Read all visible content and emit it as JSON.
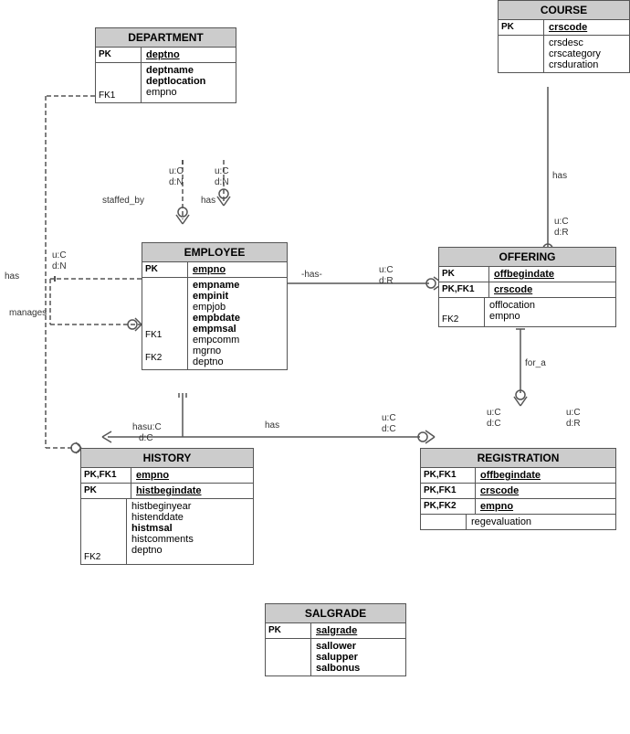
{
  "entities": {
    "department": {
      "title": "DEPARTMENT",
      "pk_label": "PK",
      "pk_field": "deptno",
      "fk_label": "FK1",
      "fields": [
        "deptname",
        "deptlocation",
        "empno"
      ],
      "bold_fields": [
        "deptname",
        "deptlocation"
      ]
    },
    "employee": {
      "title": "EMPLOYEE",
      "pk_label": "PK",
      "pk_field": "empno",
      "fk_labels": [
        "FK1",
        "FK2"
      ],
      "fields": [
        "empname",
        "empinit",
        "empjob",
        "empbdate",
        "empmsal",
        "empcomm",
        "mgrno",
        "deptno"
      ],
      "bold_fields": [
        "empname",
        "empinit",
        "empbdate",
        "empmsal"
      ]
    },
    "history": {
      "title": "HISTORY",
      "pk_rows": [
        {
          "label": "PK,FK1",
          "field": "empno",
          "underline": true
        },
        {
          "label": "PK",
          "field": "histbegindate",
          "underline": true
        }
      ],
      "fk_label": "FK2",
      "fields": [
        "histbeginyear",
        "histenddate",
        "histmsal",
        "histcomments",
        "deptno"
      ],
      "bold_fields": [
        "histmsal"
      ]
    },
    "course": {
      "title": "COURSE",
      "pk_label": "PK",
      "pk_field": "crscode",
      "fields": [
        "crsdesc",
        "crscategory",
        "crsduration"
      ],
      "bold_fields": []
    },
    "offering": {
      "title": "OFFERING",
      "pk_rows": [
        {
          "label": "PK",
          "field": "offbegindate",
          "underline": true
        },
        {
          "label": "PK,FK1",
          "field": "crscode",
          "underline": true
        }
      ],
      "fk_label": "FK2",
      "fields": [
        "offlocation",
        "empno"
      ],
      "bold_fields": []
    },
    "registration": {
      "title": "REGISTRATION",
      "pk_rows": [
        {
          "label": "PK,FK1",
          "field": "offbegindate",
          "underline": true
        },
        {
          "label": "PK,FK1",
          "field": "crscode",
          "underline": true
        },
        {
          "label": "PK,FK2",
          "field": "empno",
          "underline": true
        }
      ],
      "fields": [
        "regevaluation"
      ],
      "bold_fields": []
    },
    "salgrade": {
      "title": "SALGRADE",
      "pk_label": "PK",
      "pk_field": "salgrade",
      "fields": [
        "sallower",
        "salupper",
        "salbonus"
      ],
      "bold_fields": [
        "sallower",
        "salupper",
        "salbonus"
      ]
    }
  },
  "relationships": {
    "labels": [
      "staffed_by",
      "has",
      "has",
      "manages",
      "has",
      "has",
      "for_a"
    ]
  }
}
